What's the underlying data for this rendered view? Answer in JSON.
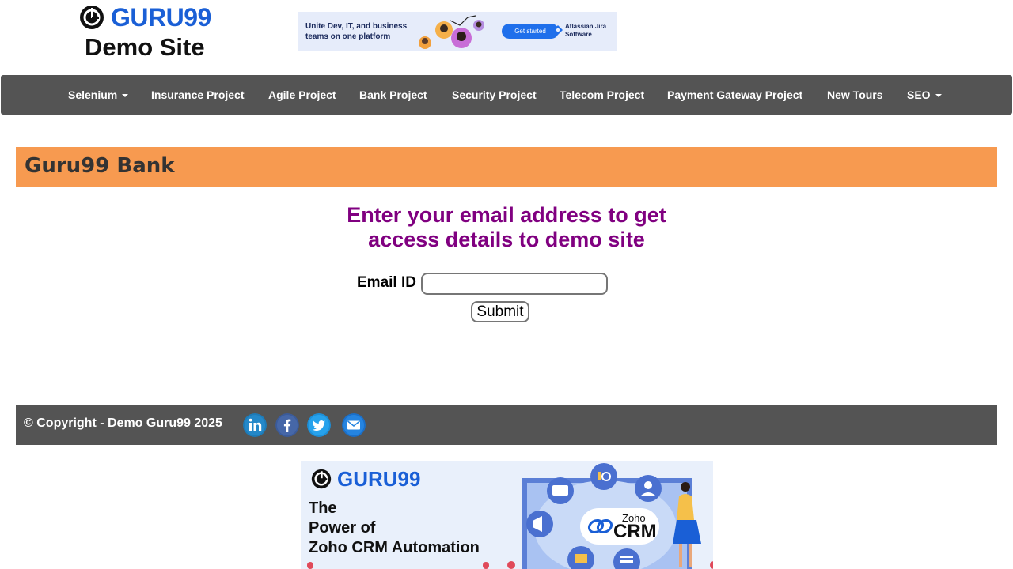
{
  "header": {
    "logo_text": "GURU99",
    "logo_subtitle": "Demo Site",
    "ad": {
      "headline": "Unite Dev, IT, and business teams on one platform",
      "button": "Get started",
      "brand": "Atlassian Jira Software"
    }
  },
  "nav": {
    "items": [
      {
        "label": "Selenium",
        "dropdown": true
      },
      {
        "label": "Insurance Project",
        "dropdown": false
      },
      {
        "label": "Agile Project",
        "dropdown": false
      },
      {
        "label": "Bank Project",
        "dropdown": false
      },
      {
        "label": "Security Project",
        "dropdown": false
      },
      {
        "label": "Telecom Project",
        "dropdown": false
      },
      {
        "label": "Payment Gateway Project",
        "dropdown": false
      },
      {
        "label": "New Tours",
        "dropdown": false
      },
      {
        "label": "SEO",
        "dropdown": true
      }
    ]
  },
  "bank": {
    "title": "Guru99 Bank"
  },
  "form": {
    "headline_line1": "Enter your email address to get",
    "headline_line2": "access details to demo site",
    "email_label": "Email ID",
    "email_value": "",
    "submit_label": "Submit"
  },
  "footer": {
    "copyright": "© Copyright - Demo Guru99 2025",
    "social": [
      "linkedin-icon",
      "facebook-icon",
      "twitter-icon",
      "email-icon"
    ]
  },
  "bottom_ad": {
    "logo_text": "GURU99",
    "line1": "The",
    "line2": "Power of",
    "line3": "Zoho CRM Automation",
    "product_brand": "Zoho",
    "product_name": "CRM"
  },
  "colors": {
    "nav_bg": "#545454",
    "bank_bar": "#f79a50",
    "headline": "#800080",
    "logo_blue": "#1a5fd6"
  }
}
